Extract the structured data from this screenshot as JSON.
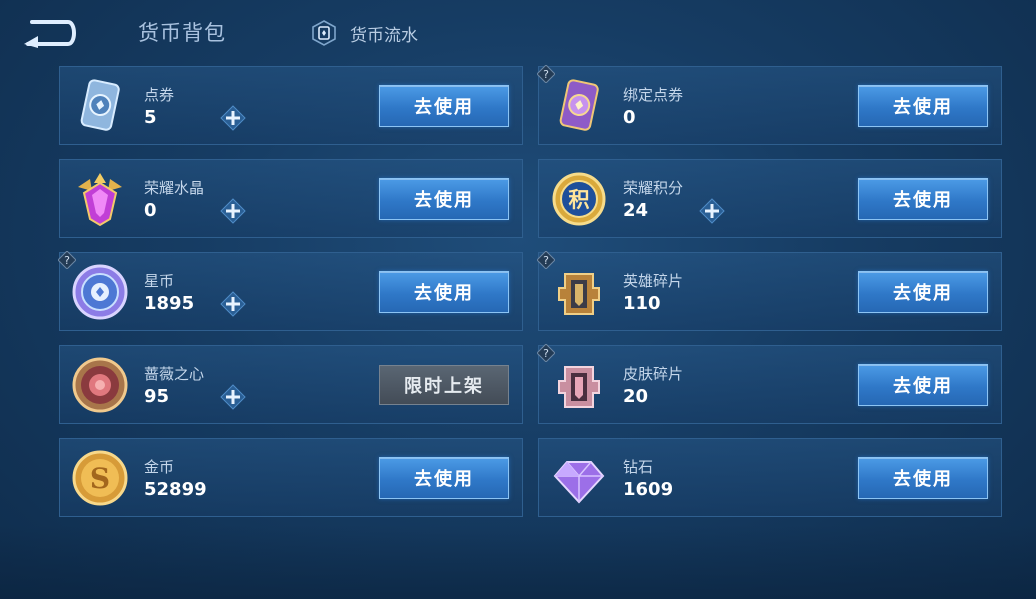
{
  "header": {
    "title": "货币背包",
    "flow_label": "货币流水"
  },
  "cards": [
    {
      "name": "点券",
      "amount": "5",
      "action": "去使用",
      "has_plus": true,
      "has_help": false,
      "icon": "coupon-icon"
    },
    {
      "name": "绑定点券",
      "amount": "0",
      "action": "去使用",
      "has_plus": false,
      "has_help": true,
      "icon": "bound-coupon-icon"
    },
    {
      "name": "荣耀水晶",
      "amount": "0",
      "action": "去使用",
      "has_plus": true,
      "has_help": false,
      "icon": "glory-crystal-icon"
    },
    {
      "name": "荣耀积分",
      "amount": "24",
      "action": "去使用",
      "has_plus": true,
      "has_help": false,
      "icon": "glory-points-icon"
    },
    {
      "name": "星币",
      "amount": "1895",
      "action": "去使用",
      "has_plus": true,
      "has_help": true,
      "icon": "star-coin-icon"
    },
    {
      "name": "英雄碎片",
      "amount": "110",
      "action": "去使用",
      "has_plus": false,
      "has_help": true,
      "icon": "hero-fragment-icon"
    },
    {
      "name": "蔷薇之心",
      "amount": "95",
      "action": "限时上架",
      "has_plus": true,
      "has_help": false,
      "icon": "rose-heart-icon"
    },
    {
      "name": "皮肤碎片",
      "amount": "20",
      "action": "去使用",
      "has_plus": false,
      "has_help": true,
      "icon": "skin-fragment-icon"
    },
    {
      "name": "金币",
      "amount": "52899",
      "action": "去使用",
      "has_plus": false,
      "has_help": false,
      "icon": "gold-coin-icon"
    },
    {
      "name": "钻石",
      "amount": "1609",
      "action": "去使用",
      "has_plus": false,
      "has_help": false,
      "icon": "diamond-icon"
    }
  ],
  "colors": {
    "background": "#163c63",
    "card_border": "#2f5f8f",
    "use_button": "#2f78c8",
    "limited_button": "#4b5560"
  }
}
